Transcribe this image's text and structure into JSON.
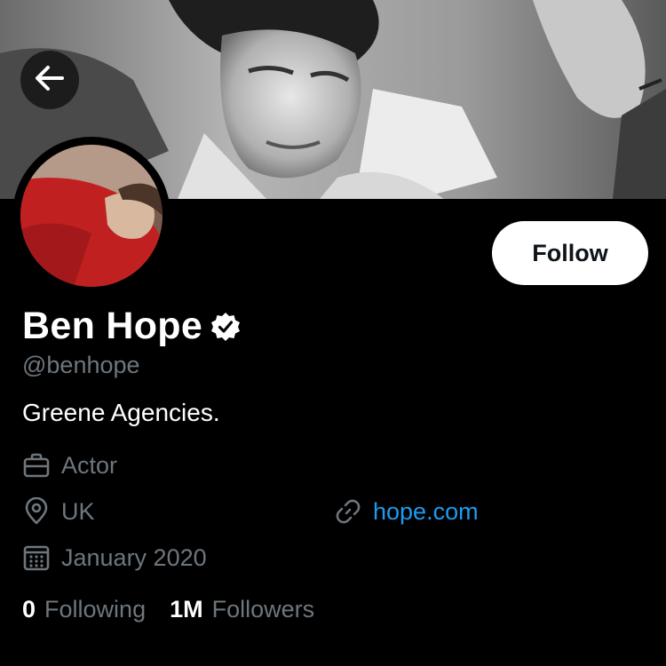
{
  "profile": {
    "display_name": "Ben Hope",
    "handle": "@benhope",
    "bio": "Greene Agencies.",
    "verified": true
  },
  "actions": {
    "follow_label": "Follow"
  },
  "meta": {
    "profession": "Actor",
    "location": "UK",
    "website": "hope.com",
    "joined": "January 2020"
  },
  "stats": {
    "following_count": "0",
    "following_label": "Following",
    "followers_count": "1M",
    "followers_label": "Followers"
  },
  "icons": {
    "back": "arrow-left-icon",
    "verified": "verified-badge-icon",
    "profession": "briefcase-icon",
    "location": "location-pin-icon",
    "website": "link-icon",
    "joined": "calendar-icon"
  },
  "colors": {
    "background": "#000000",
    "secondary_text": "#6e767d",
    "link": "#1d9bf0",
    "follow_button_bg": "#ffffff",
    "avatar_accent": "#c0201f"
  }
}
